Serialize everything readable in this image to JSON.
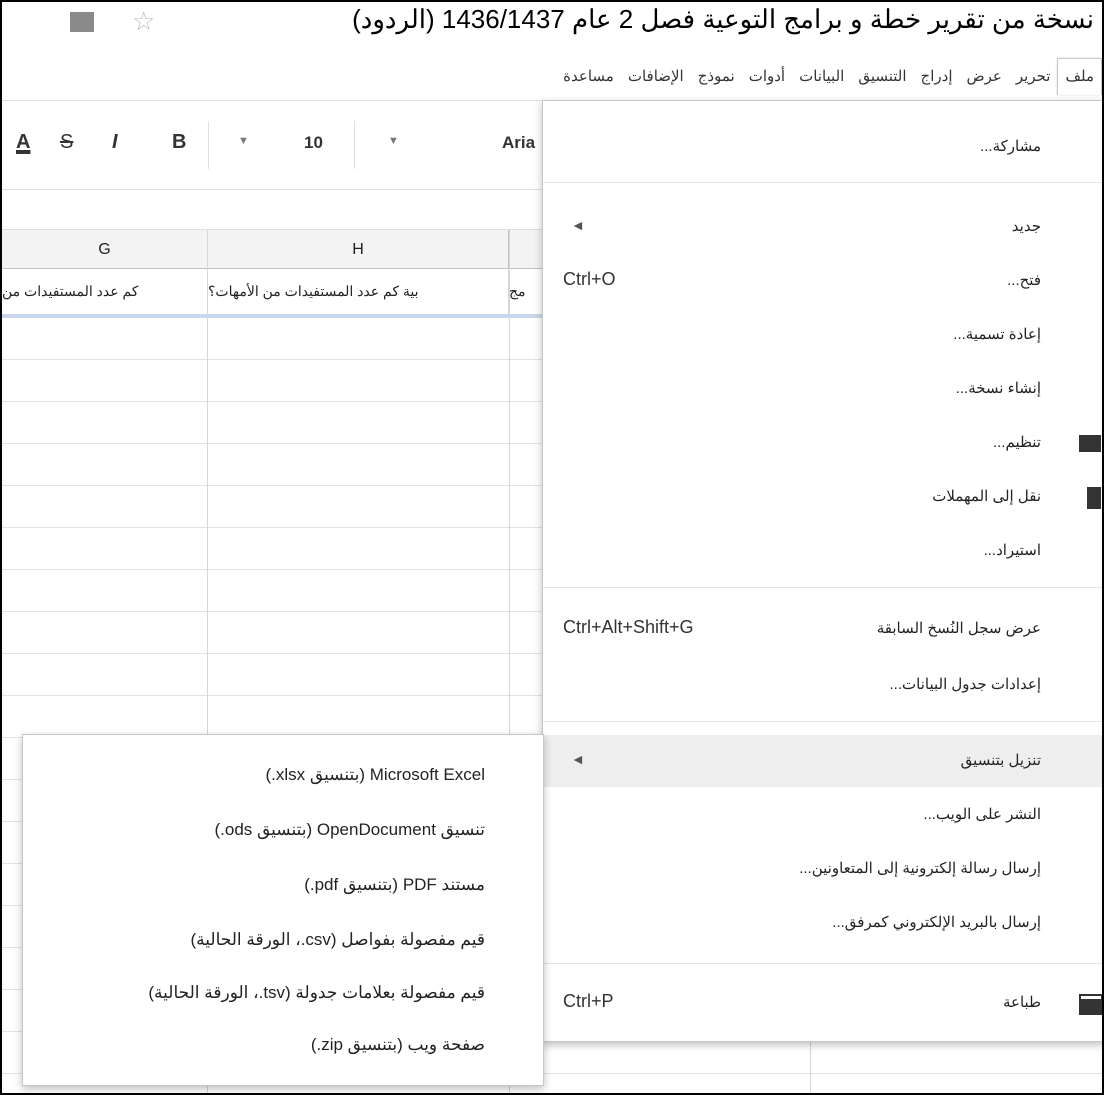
{
  "title_bar": {
    "doc_title": "نسخة من تقرير خطة و برامج التوعية فصل 2 عام 1436/1437 (الردود)",
    "star_icon": "star-outline-icon",
    "folder_icon": "folder-icon"
  },
  "menu_bar": {
    "items": [
      "ملف",
      "تحرير",
      "عرض",
      "إدراج",
      "التنسيق",
      "البيانات",
      "أدوات",
      "نموذج",
      "الإضافات",
      "مساعدة"
    ]
  },
  "toolbar": {
    "text_color": "A",
    "strike": "S",
    "italic": "I",
    "bold": "B",
    "font_size": "10",
    "font_name": "Aria"
  },
  "grid": {
    "columns": [
      "G",
      "H"
    ],
    "header_cells": [
      "كم عدد المستفيدات من",
      "بية كم عدد المستفيدات من الأمهات؟",
      "مج"
    ]
  },
  "file_menu": {
    "share": "مشاركة...",
    "new": "جديد",
    "open": "فتح...",
    "open_shortcut": "Ctrl+O",
    "rename": "إعادة تسمية...",
    "make_copy": "إنشاء نسخة...",
    "organize": "تنظيم...",
    "move_to_trash": "نقل إلى المهملات",
    "import": "استيراد...",
    "revision_history": "عرض سجل النُسخ السابقة",
    "revision_shortcut": "Ctrl+Alt+Shift+G",
    "spreadsheet_settings": "إعدادات جدول البيانات...",
    "download_as": "تنزيل بتنسيق",
    "publish": "النشر على الويب...",
    "email_collaborators": "إرسال رسالة إلكترونية إلى المتعاونين...",
    "email_attachment": "إرسال بالبريد الإلكتروني كمرفق...",
    "print": "طباعة",
    "print_shortcut": "Ctrl+P",
    "submenu_arrow": "◄"
  },
  "download_submenu": {
    "items": [
      "Microsoft Excel (بتنسيق xlsx.)",
      "تنسيق OpenDocument (بتنسيق ods.)",
      "مستند PDF (بتنسيق pdf.)",
      "قيم مفصولة بفواصل (csv.، الورقة الحالية)",
      "قيم مفصولة بعلامات جدولة (tsv.، الورقة الحالية)",
      "صفحة ويب (بتنسيق zip.)"
    ]
  },
  "colors": {
    "frame_border": "#000000",
    "highlight": "#eeeeee",
    "selection_band": "#c9d7ee"
  }
}
